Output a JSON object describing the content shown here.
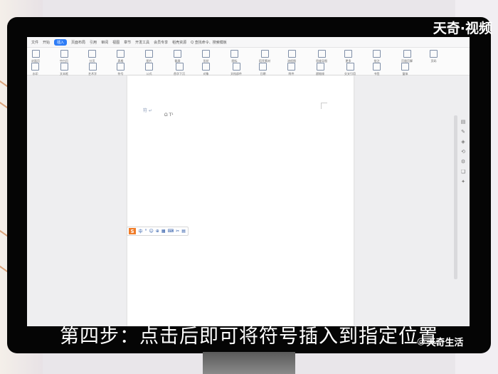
{
  "overlay": {
    "brand": "天奇·视频",
    "subtitle": "第四步：点击后即可将符号插入到指定位置",
    "watermark": "天奇生活"
  },
  "app": {
    "tabs": [
      "文件",
      "开始",
      "插入",
      "页面布局",
      "引用",
      "审阅",
      "视图",
      "章节",
      "开发工具",
      "会员专享",
      "稻壳资源"
    ],
    "active_tab": "插入",
    "search_hint": "Q 查找命令、搜索模板"
  },
  "ribbon": {
    "groups": [
      "封面页",
      "空白页",
      "分页",
      "表格",
      "图片",
      "截屏",
      "形状",
      "图标",
      "稻壳素材",
      "流程图",
      "思维导图",
      "更多",
      "批注",
      "页眉页脚",
      "页码",
      "水印",
      "文本框",
      "艺术字",
      "符号",
      "公式",
      "首字下沉",
      "对象",
      "文档部件",
      "日期",
      "附件",
      "超链接",
      "交叉引用",
      "书签",
      "窗体"
    ]
  },
  "document": {
    "mark_text": "符 ↵",
    "cursor_mark": "Ω T¹"
  },
  "ime": {
    "logo": "S",
    "items": [
      "中",
      "°",
      "☺",
      "⊕",
      "▦",
      "⌨",
      "✂",
      "▤"
    ]
  },
  "sidebar": {
    "icons": [
      "▤",
      "✎",
      "◈",
      "⟲",
      "⚙",
      "❏",
      "✦"
    ]
  }
}
